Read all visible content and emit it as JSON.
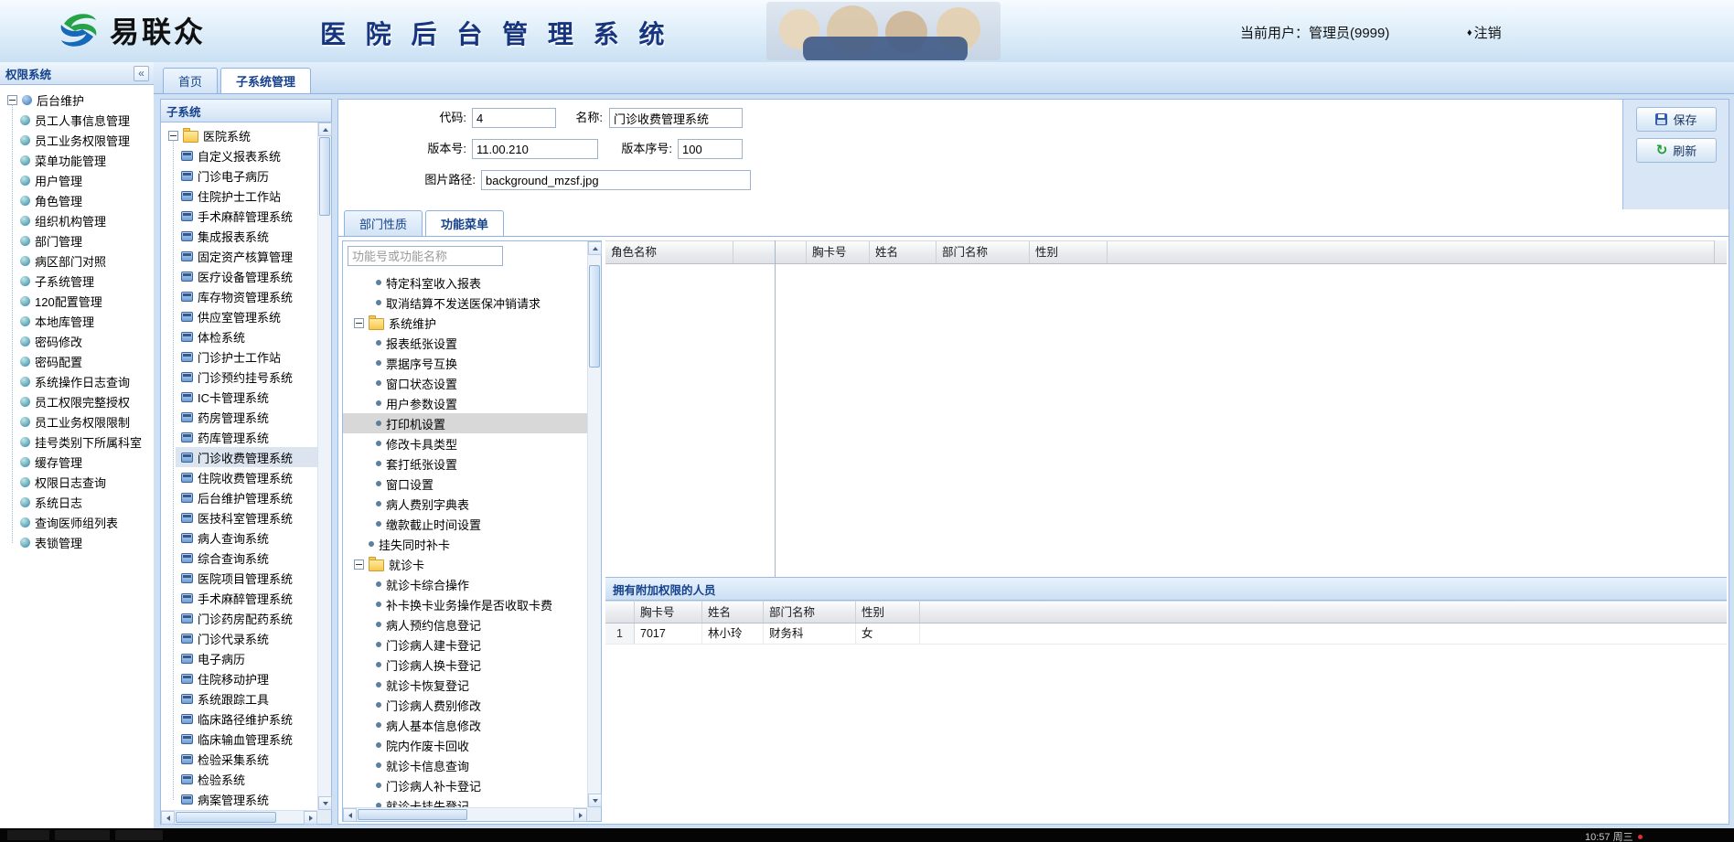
{
  "header": {
    "logo_text": "易联众",
    "app_title": "医 院 后 台 管 理 系 统",
    "current_user": "当前用户：管理员(9999)",
    "logout": {
      "icon": "♦",
      "label": "注销"
    }
  },
  "main_tabs": [
    {
      "label": "首页",
      "active": false
    },
    {
      "label": "子系统管理",
      "active": true
    }
  ],
  "sidebar": {
    "title": "权限系统",
    "collapse_icon": "«",
    "root_label": "后台维护",
    "items": [
      "员工人事信息管理",
      "员工业务权限管理",
      "菜单功能管理",
      "用户管理",
      "角色管理",
      "组织机构管理",
      "部门管理",
      "病区部门对照",
      "子系统管理",
      "120配置管理",
      "本地库管理",
      "密码修改",
      "密码配置",
      "系统操作日志查询",
      "员工权限完整授权",
      "员工业务权限限制",
      "挂号类别下所属科室",
      "缓存管理",
      "权限日志查询",
      "系统日志",
      "查询医师组列表",
      "表锁管理"
    ]
  },
  "subsystems": {
    "panel_title": "子系统",
    "root_label": "医院系统",
    "selected": "门诊收费管理系统",
    "items": [
      "自定义报表系统",
      "门诊电子病历",
      "住院护士工作站",
      "手术麻醉管理系统",
      "集成报表系统",
      "固定资产核算管理",
      "医疗设备管理系统",
      "库存物资管理系统",
      "供应室管理系统",
      "体检系统",
      "门诊护士工作站",
      "门诊预约挂号系统",
      "IC卡管理系统",
      "药房管理系统",
      "药库管理系统",
      "门诊收费管理系统",
      "住院收费管理系统",
      "后台维护管理系统",
      "医技科室管理系统",
      "病人查询系统",
      "综合查询系统",
      "医院项目管理系统",
      "手术麻醉管理系统",
      "门诊药房配药系统",
      "门诊代录系统",
      "电子病历",
      "住院移动护理",
      "系统跟踪工具",
      "临床路径维护系统",
      "临床输血管理系统",
      "检验采集系统",
      "检验系统",
      "病案管理系统"
    ]
  },
  "form": {
    "fields": [
      {
        "label": "代码:",
        "value": "4"
      },
      {
        "label": "名称:",
        "value": "门诊收费管理系统"
      },
      {
        "label": "版本号:",
        "value": "11.00.210"
      },
      {
        "label": "版本序号:",
        "value": "100"
      },
      {
        "label": "图片路径:",
        "value": "background_mzsf.jpg"
      }
    ],
    "save_label": "保存",
    "refresh_label": "刷新",
    "refresh_icon": "↻"
  },
  "detail_tabs": [
    {
      "label": "部门性质",
      "active": false
    },
    {
      "label": "功能菜单",
      "active": true
    }
  ],
  "function_menu": {
    "search_placeholder": "功能号或功能名称",
    "tree": [
      {
        "label": "特定科室收入报表",
        "type": "leaf",
        "level": 1
      },
      {
        "label": "取消结算不发送医保冲销请求",
        "type": "leaf",
        "level": 1
      },
      {
        "label": "系统维护",
        "type": "folder",
        "level": 0
      },
      {
        "label": "报表纸张设置",
        "type": "leaf",
        "level": 1
      },
      {
        "label": "票据序号互换",
        "type": "leaf",
        "level": 1
      },
      {
        "label": "窗口状态设置",
        "type": "leaf",
        "level": 1
      },
      {
        "label": "用户参数设置",
        "type": "leaf",
        "level": 1
      },
      {
        "label": "打印机设置",
        "type": "leaf",
        "level": 1,
        "selected": true
      },
      {
        "label": "修改卡具类型",
        "type": "leaf",
        "level": 1
      },
      {
        "label": "套打纸张设置",
        "type": "leaf",
        "level": 1
      },
      {
        "label": "窗口设置",
        "type": "leaf",
        "level": 1
      },
      {
        "label": "病人费别字典表",
        "type": "leaf",
        "level": 1
      },
      {
        "label": "缴款截止时间设置",
        "type": "leaf",
        "level": 1
      },
      {
        "label": "挂失同时补卡",
        "type": "leaf",
        "level": 0
      },
      {
        "label": "就诊卡",
        "type": "folder",
        "level": 0
      },
      {
        "label": "就诊卡综合操作",
        "type": "leaf",
        "level": 1
      },
      {
        "label": "补卡换卡业务操作是否收取卡费",
        "type": "leaf",
        "level": 1
      },
      {
        "label": "病人预约信息登记",
        "type": "leaf",
        "level": 1
      },
      {
        "label": "门诊病人建卡登记",
        "type": "leaf",
        "level": 1
      },
      {
        "label": "门诊病人换卡登记",
        "type": "leaf",
        "level": 1
      },
      {
        "label": "就诊卡恢复登记",
        "type": "leaf",
        "level": 1
      },
      {
        "label": "门诊病人费别修改",
        "type": "leaf",
        "level": 1
      },
      {
        "label": "病人基本信息修改",
        "type": "leaf",
        "level": 1
      },
      {
        "label": "院内作废卡回收",
        "type": "leaf",
        "level": 1
      },
      {
        "label": "就诊卡信息查询",
        "type": "leaf",
        "level": 1
      },
      {
        "label": "门诊病人补卡登记",
        "type": "leaf",
        "level": 1
      },
      {
        "label": "就诊卡挂失登记",
        "type": "leaf",
        "level": 1
      }
    ]
  },
  "roles_grid": {
    "headers": [
      "角色名称"
    ],
    "rows": []
  },
  "members_grid": {
    "headers": [
      "胸卡号",
      "姓名",
      "部门名称",
      "性别"
    ],
    "rows": []
  },
  "attached_panel": {
    "title": "拥有附加权限的人员",
    "headers": [
      "胸卡号",
      "姓名",
      "部门名称",
      "性别"
    ],
    "rows": [
      {
        "num": "1",
        "cells": [
          "7017",
          "林小玲",
          "财务科",
          "女"
        ]
      }
    ]
  },
  "taskbar": {
    "clock": "10:57 周三"
  }
}
